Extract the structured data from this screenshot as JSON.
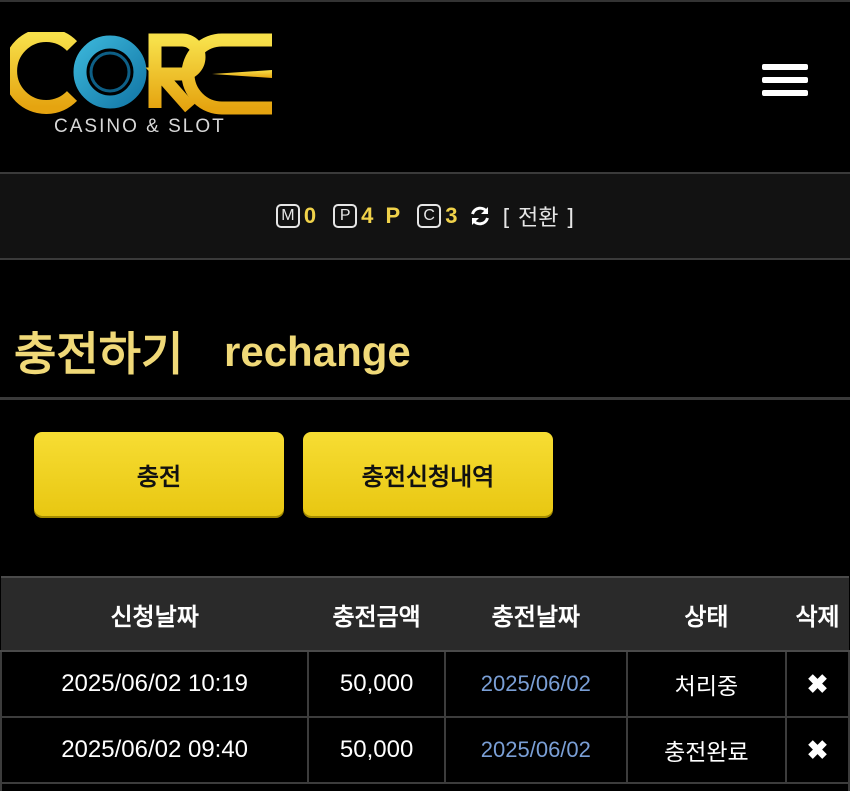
{
  "header": {
    "logo_text": "CORE",
    "logo_sub": "CASINO & SLOT",
    "menu_icon": "hamburger-menu-icon"
  },
  "points": {
    "m_badge": "M",
    "m_value": "0",
    "p_badge": "P",
    "p_value": "4 P",
    "c_badge": "C",
    "c_value": "3",
    "refresh_icon": "refresh-icon",
    "switch_label": "[ 전환 ]"
  },
  "page_title": {
    "korean": "충전하기",
    "english": "rechange"
  },
  "buttons": {
    "charge": "충전",
    "history": "충전신청내역"
  },
  "table": {
    "headers": [
      "신청날짜",
      "충전금액",
      "충전날짜",
      "상태",
      "삭제"
    ],
    "rows": [
      {
        "request_date": "2025/06/02 10:19",
        "amount": "50,000",
        "charge_date": "2025/06/02",
        "status": "처리중",
        "delete": "✖"
      },
      {
        "request_date": "2025/06/02 09:40",
        "amount": "50,000",
        "charge_date": "2025/06/02",
        "status": "충전완료",
        "delete": "✖"
      }
    ]
  },
  "colors": {
    "accent_yellow": "#f0d24a",
    "title_yellow": "#f0d978",
    "link_blue": "#7a9fd6",
    "background": "#000000"
  }
}
